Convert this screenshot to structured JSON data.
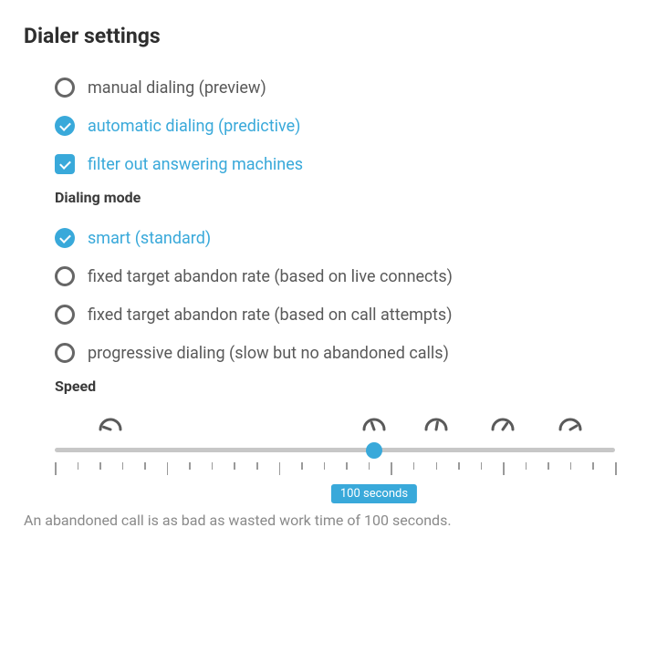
{
  "title": "Dialer settings",
  "dial_type": {
    "options": [
      {
        "label": "manual dialing (preview)",
        "selected": false
      },
      {
        "label": "automatic dialing (predictive)",
        "selected": true
      }
    ],
    "filter_label": "filter out answering machines",
    "filter_checked": true
  },
  "dialing_mode": {
    "heading": "Dialing mode",
    "options": [
      {
        "label": "smart (standard)",
        "selected": true
      },
      {
        "label": "fixed target abandon rate (based on live connects)",
        "selected": false
      },
      {
        "label": "fixed target abandon rate (based on call attempts)",
        "selected": false
      },
      {
        "label": "progressive dialing (slow but no abandoned calls)",
        "selected": false
      }
    ]
  },
  "speed": {
    "heading": "Speed",
    "value_seconds": 100,
    "bubble_text": "100 seconds",
    "thumb_percent": 57,
    "gauge_positions_percent": [
      10,
      57,
      68,
      80,
      92
    ],
    "caption": "An abandoned call is as bad as wasted work time of 100 seconds."
  }
}
